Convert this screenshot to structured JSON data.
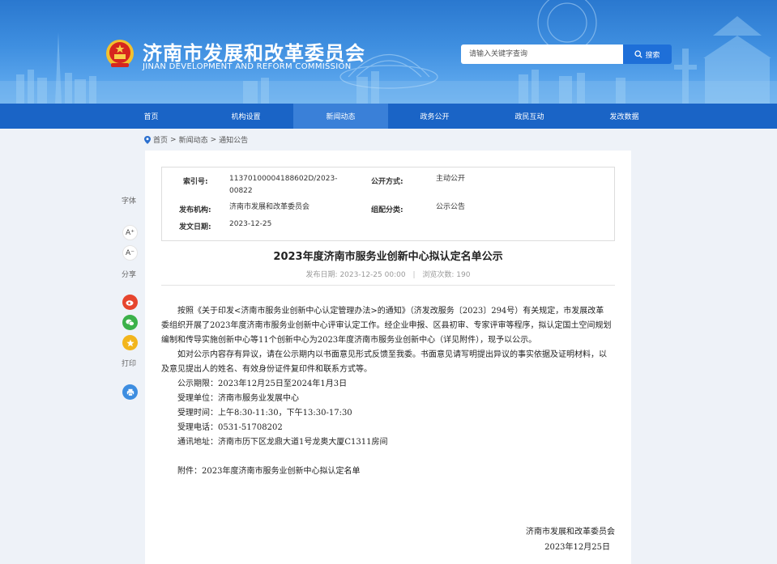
{
  "header": {
    "title": "济南市发展和改革委员会",
    "subtitle": "JINAN DEVELOPMENT AND REFORM COMMISSION",
    "search_placeholder": "请输入关键字查询",
    "search_button": "搜索"
  },
  "nav": [
    {
      "label": "首页",
      "active": false
    },
    {
      "label": "机构设置",
      "active": false
    },
    {
      "label": "新闻动态",
      "active": true
    },
    {
      "label": "政务公开",
      "active": false
    },
    {
      "label": "政民互动",
      "active": false
    },
    {
      "label": "发改数据",
      "active": false
    }
  ],
  "breadcrumb": {
    "home": "首页",
    "sep": ">",
    "level1": "新闻动态",
    "level2": "通知公告"
  },
  "meta": {
    "index_label": "索引号:",
    "index_value": "11370100004188602D/2023-00822",
    "publish_type_label": "公开方式:",
    "publish_type_value": "主动公开",
    "org_label": "发布机构:",
    "org_value": "济南市发展和改革委员会",
    "category_label": "组配分类:",
    "category_value": "公示公告",
    "date_label": "发文日期:",
    "date_value": "2023-12-25"
  },
  "article": {
    "title": "2023年度济南市服务业创新中心拟认定名单公示",
    "publish_date_label": "发布日期:",
    "publish_date": "2023-12-25 00:00",
    "views_label": "浏览次数:",
    "views": "190",
    "para1": "按照《关于印发<济南市服务业创新中心认定管理办法>的通知》（济发改服务〔2023〕294号）有关规定，市发展改革委组织开展了2023年度济南市服务业创新中心评审认定工作。经企业申报、区县初审、专家评审等程序，拟认定国土空间规划编制和传导实施创新中心等11个创新中心为2023年度济南市服务业创新中心（详见附件），现予以公示。",
    "para2": "如对公示内容存有异议，请在公示期内以书面意见形式反馈至我委。书面意见请写明提出异议的事实依据及证明材料，以及意见提出人的姓名、有效身份证件复印件和联系方式等。",
    "lines": [
      "公示期限：2023年12月25日至2024年1月3日",
      "受理单位：济南市服务业发展中心",
      "受理时间：上午8:30-11:30，下午13:30-17:30",
      "受理电话：0531-51708202",
      "通讯地址：济南市历下区龙鼎大道1号龙奥大厦C1311房间"
    ],
    "attachment": "附件：2023年度济南市服务业创新中心拟认定名单",
    "signature_org": "济南市发展和改革委员会",
    "signature_date": "2023年12月25日"
  },
  "sidebar": {
    "font_label": "字体",
    "font_increase": "A⁺",
    "font_decrease": "A⁻",
    "share_label": "分享",
    "print_label": "打印"
  },
  "colors": {
    "nav_bg": "#1a64c6",
    "nav_active": "#3a80d8",
    "search_button": "#1e6fd8",
    "weibo": "#e6452e",
    "wechat": "#3bb14a",
    "qzone": "#f2b51c",
    "print": "#3d8de0"
  }
}
